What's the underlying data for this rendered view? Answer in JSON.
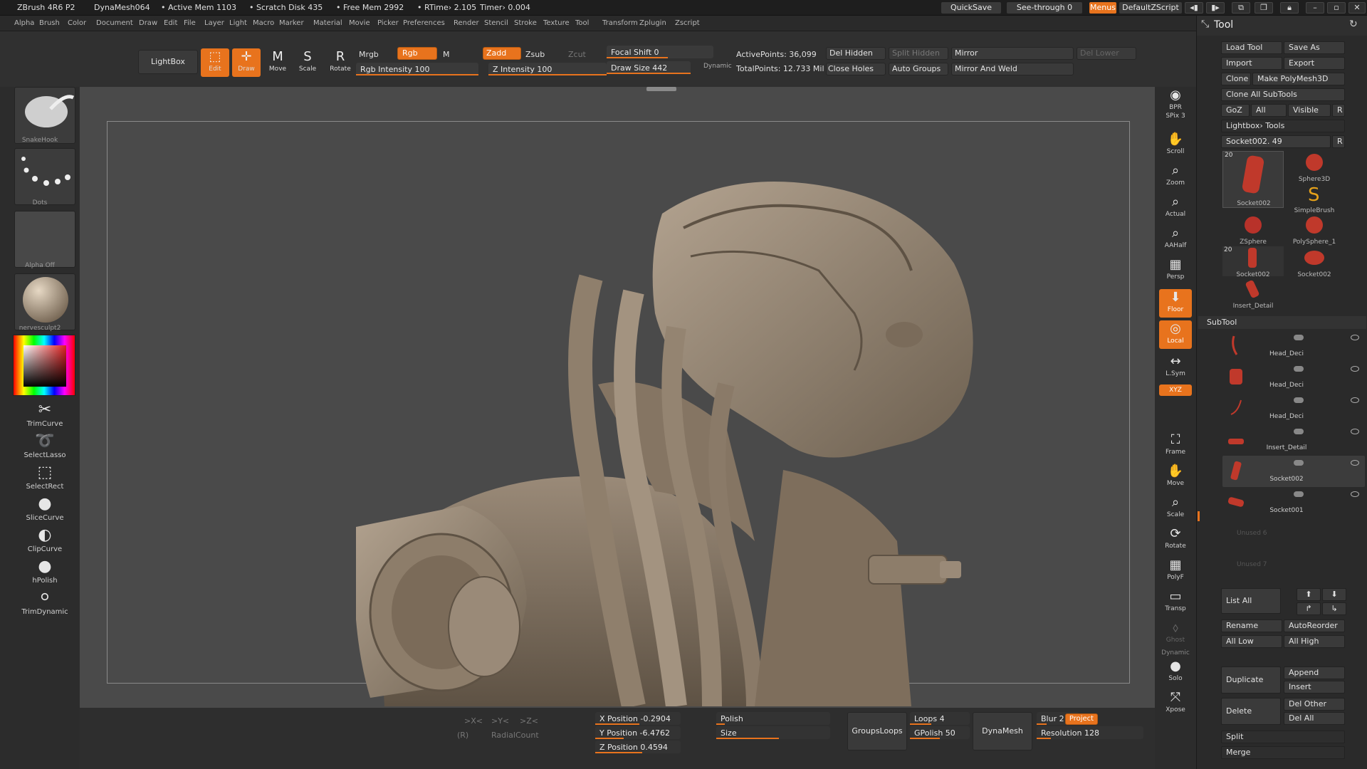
{
  "titlebar": {
    "app": "ZBrush 4R6 P2",
    "document": "DynaMesh064",
    "active_mem": "• Active Mem 1103",
    "scratch_disk": "• Scratch Disk 435",
    "free_mem": "• Free Mem 2992",
    "rtime": "• RTime› 2.105",
    "timer": "Timer› 0.004",
    "quicksave": "QuickSave",
    "see_through": "See-through  0",
    "menus": "Menus",
    "default_zscript": "DefaultZScript"
  },
  "menu": [
    "Alpha",
    "Brush",
    "Color",
    "Document",
    "Draw",
    "Edit",
    "File",
    "Layer",
    "Light",
    "Macro",
    "Marker",
    "Material",
    "Movie",
    "Picker",
    "Preferences",
    "Render",
    "Stencil",
    "Stroke",
    "Texture",
    "Tool",
    "Transform",
    "Zplugin",
    "Zscript"
  ],
  "toolbar": {
    "lightbox": "LightBox",
    "edit": "Edit",
    "draw": "Draw",
    "move": "Move",
    "scale": "Scale",
    "rotate": "Rotate",
    "mrgb": "Mrgb",
    "rgb": "Rgb",
    "m": "M",
    "zadd": "Zadd",
    "zsub": "Zsub",
    "zcut": "Zcut",
    "rgb_intensity": "Rgb  Intensity 100",
    "z_intensity": "Z  Intensity 100",
    "focal_shift": "Focal  Shift 0",
    "draw_size": "Draw  Size 442",
    "dynamic": "Dynamic",
    "active_points": "ActivePoints: 36,099",
    "total_points": "TotalPoints: 12.733 Mil",
    "del_hidden": "Del Hidden",
    "split_hidden": "Split Hidden",
    "close_holes": "Close Holes",
    "auto_groups": "Auto Groups",
    "mirror": "Mirror",
    "mirror_and_weld": "Mirror And Weld",
    "del_lower": "Del Lower"
  },
  "left_shelf": {
    "brush": "SnakeHook",
    "stroke": "Dots",
    "alpha": "Alpha  Off",
    "material": "nervesculpt2",
    "tools": [
      {
        "label": "TrimCurve",
        "icon": "trimcurve-icon"
      },
      {
        "label": "SelectLasso",
        "icon": "selectlasso-icon"
      },
      {
        "label": "SelectRect",
        "icon": "selectrect-icon"
      },
      {
        "label": "SliceCurve",
        "icon": "slicecurve-icon"
      },
      {
        "label": "ClipCurve",
        "icon": "clipcurve-icon"
      },
      {
        "label": "hPolish",
        "icon": "hpolish-icon"
      },
      {
        "label": "TrimDynamic",
        "icon": "trimdynamic-icon"
      }
    ]
  },
  "right_strip": [
    {
      "label": "BPR",
      "icon": "bpr-icon"
    },
    {
      "label": "SPix 3",
      "icon": "spix-icon"
    },
    {
      "label": "Scroll",
      "icon": "scroll-icon"
    },
    {
      "label": "Zoom",
      "icon": "zoom-icon"
    },
    {
      "label": "Actual",
      "icon": "actual-icon"
    },
    {
      "label": "AAHalf",
      "icon": "aahalf-icon"
    },
    {
      "label": "Persp",
      "icon": "persp-icon"
    },
    {
      "label": "Floor",
      "icon": "floor-icon"
    },
    {
      "label": "Local",
      "icon": "local-icon"
    },
    {
      "label": "L.Sym",
      "icon": "lsym-icon"
    },
    {
      "label": "XYZ",
      "icon": "xyz-icon"
    },
    {
      "label": "Frame",
      "icon": "frame-icon"
    },
    {
      "label": "Move",
      "icon": "move-icon"
    },
    {
      "label": "Scale",
      "icon": "scale-icon"
    },
    {
      "label": "Rotate",
      "icon": "rotate-icon"
    },
    {
      "label": "PolyF",
      "icon": "polyf-icon"
    },
    {
      "label": "Transp",
      "icon": "transp-icon"
    },
    {
      "label": "Ghost",
      "icon": "ghost-icon"
    },
    {
      "label": "Dynamic",
      "icon": "dynamic-icon"
    },
    {
      "label": "Solo",
      "icon": "solo-icon"
    },
    {
      "label": "Xpose",
      "icon": "xpose-icon"
    }
  ],
  "bottom": {
    "radial_count": "RadialCount",
    "x_pos": "X Position -0.2904",
    "y_pos": "Y Position -6.4762",
    "z_pos": "Z Position 0.4594",
    "polish": "Polish",
    "size": "Size",
    "groups_loops": "GroupsLoops",
    "loops": "Loops 4",
    "gpolish": "GPolish 50",
    "dynamesh": "DynaMesh",
    "blur": "Blur 2",
    "project": "Project",
    "resolution": "Resolution 128",
    "sym_x": ">X<",
    "sym_y": ">Y<",
    "sym_z": ">Z<",
    "r_label": "(R)"
  },
  "tool_panel": {
    "title": "Tool",
    "load_tool": "Load Tool",
    "save_as": "Save As",
    "import": "Import",
    "export": "Export",
    "clone": "Clone",
    "make_polymesh": "Make PolyMesh3D",
    "clone_all": "Clone  All SubTools",
    "goz": "GoZ",
    "all": "All",
    "visible": "Visible",
    "r": "R",
    "lightbox_tools": "Lightbox› Tools",
    "socket_slider": "Socket002. 49",
    "tool_thumbs": [
      {
        "label": "Socket002",
        "badge": "20",
        "color": "#c0392b"
      },
      {
        "label": "Sphere3D",
        "badge": "",
        "color": "#c0392b"
      },
      {
        "label": "SimpleBrush",
        "badge": "",
        "color": "#e6a21a"
      },
      {
        "label": "ZSphere",
        "badge": "",
        "color": "#b8322a"
      },
      {
        "label": "PolySphere_1",
        "badge": "",
        "color": "#c0392b"
      },
      {
        "label": "Socket002",
        "badge": "20",
        "color": "#c0392b"
      },
      {
        "label": "Socket002",
        "badge": "",
        "color": "#c0392b"
      },
      {
        "label": "Insert_Detail",
        "badge": "",
        "color": "#c0392b"
      }
    ],
    "subtool_header": "SubTool",
    "subtools": [
      "Head_Deci",
      "Head_Deci",
      "Head_Deci",
      "Insert_Detail",
      "Socket002",
      "Socket001",
      "Unused 6",
      "Unused 7"
    ],
    "list_all": "List  All",
    "rename": "Rename",
    "autoreorder": "AutoReorder",
    "all_low": "All Low",
    "all_high": "All High",
    "duplicate": "Duplicate",
    "append": "Append",
    "insert": "Insert",
    "delete": "Delete",
    "del_other": "Del Other",
    "del_all": "Del All",
    "split": "Split",
    "merge": "Merge"
  },
  "colors": {
    "accent": "#e8731d",
    "viewport_bg": "#4a4a4a",
    "panel_bg": "#2a2a2a",
    "model": "#9a8a78"
  }
}
